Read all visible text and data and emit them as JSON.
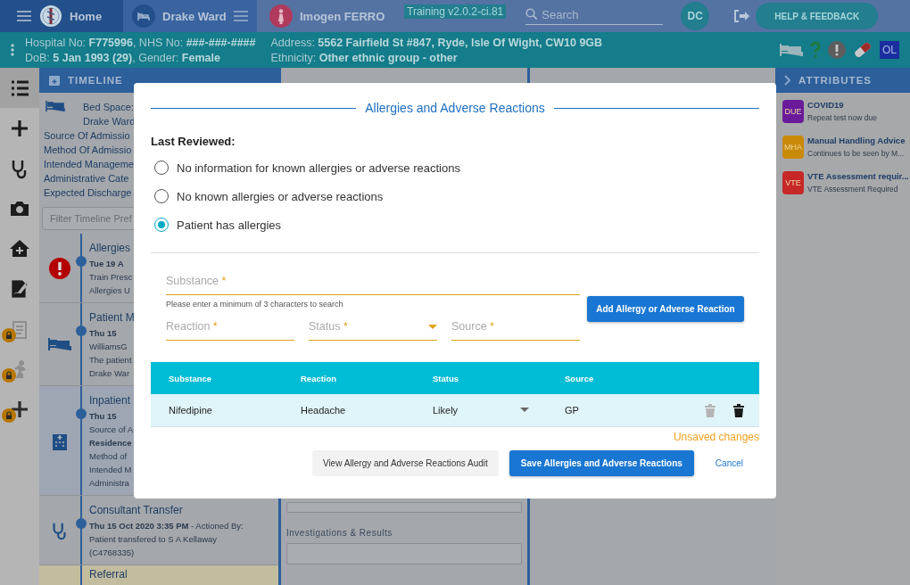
{
  "header": {
    "home": "Home",
    "ward": "Drake Ward",
    "patient": "Imogen FERRO",
    "environment": "Training v2.0.2-ci.81",
    "search": {
      "placeholder": "Search"
    },
    "user_initials": "DC",
    "help_button": "HELP & FEEDBACK"
  },
  "patient_bar": {
    "lines_left": [
      "Hospital No: **F775996**, NHS No: **###-###-####**",
      "DoB: **5 Jan 1993 (29)**, Gender: **Female**"
    ],
    "lines_right": [
      "Address: **5562 Fairfield St #847, Ryde, Isle Of Wight, CW10 9GB**",
      "Ethnicity: **Other ethnic group - other**"
    ],
    "badge": "OL"
  },
  "rail": [
    {
      "kind": "list",
      "selected": true,
      "locked": false
    },
    {
      "kind": "plus",
      "selected": false,
      "locked": false
    },
    {
      "kind": "stethoscope",
      "selected": false,
      "locked": false
    },
    {
      "kind": "camera",
      "selected": false,
      "locked": false
    },
    {
      "kind": "home",
      "selected": false,
      "locked": false
    },
    {
      "kind": "sign",
      "selected": false,
      "locked": false
    },
    {
      "kind": "clipboard",
      "selected": false,
      "locked": true
    },
    {
      "kind": "runner",
      "selected": false,
      "locked": true
    },
    {
      "kind": "plus",
      "selected": false,
      "locked": true
    }
  ],
  "timeline": {
    "title": "TIMELINE",
    "bed_lines": [
      "Bed Space:",
      "Drake Ward"
    ],
    "summary": [
      "Source Of Admissio",
      "Method Of Admissio",
      "Intended Manageme",
      "Administrative Cate",
      "Expected Discharge"
    ],
    "filter": {
      "placeholder": "Filter Timeline Pref"
    },
    "items": [
      {
        "kind": "alert",
        "title": "Allergies",
        "date": "Tue 19 A",
        "lines": [
          {
            "text": "Train Presc",
            "bold": false
          },
          {
            "text": "Allergies U",
            "bold": false
          }
        ]
      },
      {
        "kind": "bed",
        "title": "Patient M",
        "date": "Thu 15",
        "lines": [
          {
            "text": "WilliamsG",
            "bold": false
          },
          {
            "text": "The patient",
            "bold": false
          },
          {
            "text": "Drake War",
            "bold": false
          }
        ]
      },
      {
        "kind": "hospital",
        "title": "Inpatient",
        "date": "Thu 15",
        "lines": [
          {
            "text": "Source of A",
            "bold": false
          },
          {
            "text": "Residence",
            "bold": true
          },
          {
            "text": "Method of",
            "bold": false
          },
          {
            "text": "Intended M",
            "bold": false
          },
          {
            "text": "Administra",
            "bold": false
          }
        ]
      },
      {
        "kind": "stethoscope",
        "title": "Consultant Transfer",
        "date": "Thu 15 Oct 2020 3:35 PM",
        "date_suffix": " - Actioned By:",
        "lines": [
          {
            "text": "Patient transfered to S A Kellaway",
            "bold": false
          },
          {
            "text": "(C4768335)",
            "bold": false
          }
        ]
      },
      {
        "kind": "referral",
        "title": "Referral"
      }
    ]
  },
  "middle": {
    "label": "Investigations & Results"
  },
  "attributes": {
    "title": "ATTRIBUTES",
    "items": [
      {
        "badge": "DUE",
        "color": "#6a1b9a",
        "title": "COVID19",
        "subtitle": "Repeat test now due"
      },
      {
        "badge": "MHA",
        "color": "#c98a0a",
        "title": "Manual Handling Advice",
        "subtitle": "Continues to be seen by M..."
      },
      {
        "badge": "VTE",
        "color": "#c62828",
        "title": "VTE Assessment requir...",
        "subtitle": "VTE Assessment Required"
      }
    ]
  },
  "dialog": {
    "title": "Allergies and Adverse Reactions",
    "last_reviewed": "Last Reviewed:",
    "options": [
      {
        "label": "No information for known allergies or adverse reactions",
        "selected": false
      },
      {
        "label": "No known allergies or adverse reactions",
        "selected": false
      },
      {
        "label": "Patient has allergies",
        "selected": true
      }
    ],
    "substance": {
      "label": "Substance",
      "required_mark": "*",
      "hint": "Please enter a minimum of 3 characters to search"
    },
    "fields": [
      {
        "kind": "text",
        "label": "Reaction",
        "required_mark": "*"
      },
      {
        "kind": "dropdown",
        "label": "Status",
        "required_mark": "*"
      },
      {
        "kind": "text",
        "label": "Source",
        "required_mark": "*"
      }
    ],
    "add_button": "Add Allergy or Adverse Reaction",
    "table": {
      "columns": [
        "Substance",
        "Reaction",
        "Status",
        "Source"
      ],
      "rows": [
        {
          "cells": [
            "Nifedipine",
            "Headache",
            "Likely",
            "GP"
          ],
          "actions": [
            {
              "disabled": true
            },
            {
              "disabled": false
            }
          ]
        }
      ]
    },
    "note": "Unsaved changes",
    "buttons": [
      {
        "kind": "secondary",
        "label": "View Allergy and Adverse Reactions Audit"
      },
      {
        "kind": "primary",
        "label": "Save Allergies and Adverse Reactions"
      },
      {
        "kind": "text",
        "label": "Cancel"
      }
    ]
  }
}
